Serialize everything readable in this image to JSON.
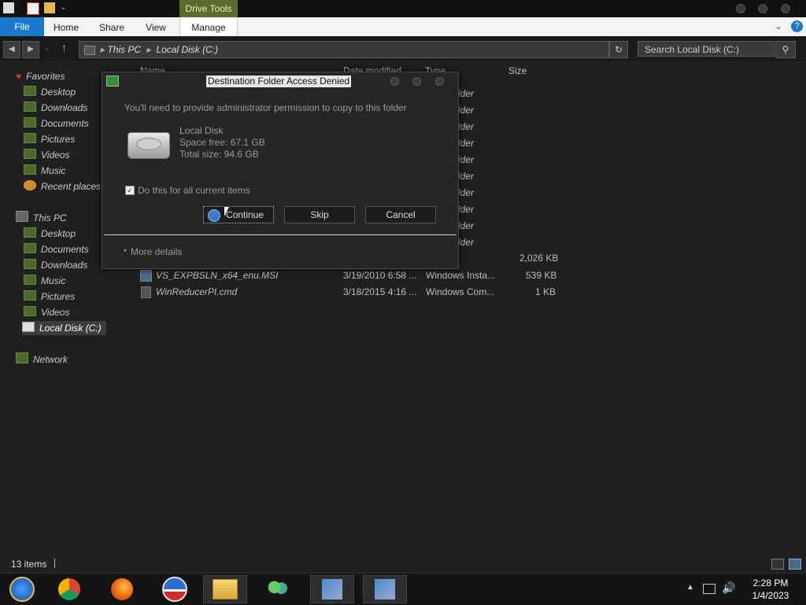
{
  "ribbon": {
    "contextual_tab": "Drive Tools",
    "tabs": [
      "File",
      "Home",
      "Share",
      "View",
      "Manage"
    ]
  },
  "address": {
    "crumbs": [
      "This PC",
      "Local Disk (C:)"
    ],
    "search_placeholder": "Search Local Disk (C:)"
  },
  "sidebar": {
    "favorites_label": "Favorites",
    "favorites": [
      "Desktop",
      "Downloads",
      "Documents",
      "Pictures",
      "Videos",
      "Music",
      "Recent places"
    ],
    "thispc_label": "This PC",
    "thispc": [
      "Desktop",
      "Documents",
      "Downloads",
      "Music",
      "Pictures",
      "Videos",
      "Local Disk (C:)"
    ],
    "network_label": "Network"
  },
  "columns": {
    "name": "Name",
    "date": "Date modified",
    "type": "Type",
    "size": "Size"
  },
  "files": {
    "visible_type_fragment": "lder",
    "row_a": {
      "size": "2,026 KB"
    },
    "row_b": {
      "name": "VS_EXPBSLN_x64_enu.MSI",
      "date": "3/19/2010 6:58 ...",
      "type": "Windows Insta...",
      "size": "539 KB"
    },
    "row_c": {
      "name": "WinReducerPI.cmd",
      "date": "3/18/2015 4:16 ...",
      "type": "Windows Com...",
      "size": "1 KB"
    }
  },
  "status": {
    "count": "13 items"
  },
  "dialog": {
    "title": "Destination Folder Access Denied",
    "message": "You'll need to provide administrator permission to copy to this folder",
    "drive_name": "Local Disk",
    "space_free": "Space free: 67.1 GB",
    "total_size": "Total size: 94.6 GB",
    "checkbox_label": "Do this for all current items",
    "checkbox_checked": true,
    "continue_label": "Continue",
    "skip_label": "Skip",
    "cancel_label": "Cancel",
    "more_details": "More details"
  },
  "taskbar": {
    "time": "2:28 PM",
    "date": "1/4/2023",
    "apps": [
      "start-orb-icon",
      "chrome-icon",
      "firefox-icon",
      "obama-logo-icon",
      "file-explorer-icon",
      "users-icon",
      "network-setup-icon",
      "network-setup-icon"
    ]
  },
  "colors": {
    "file_tab": "#1979ca",
    "drive_tools": "#5b6b2a",
    "background": "#202020"
  }
}
